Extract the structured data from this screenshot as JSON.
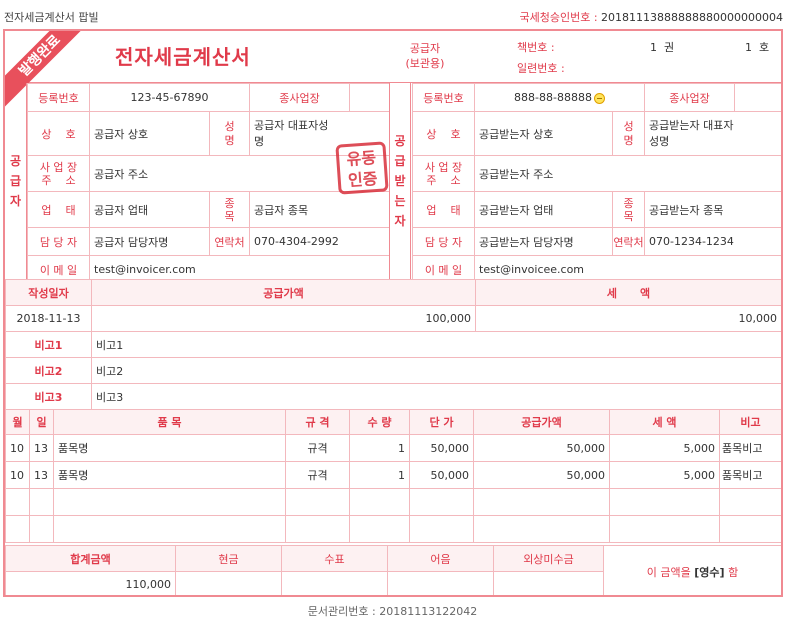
{
  "window": {
    "title": "전자세금계산서 팝빌"
  },
  "approval": {
    "label": "국세청승인번호 : ",
    "number": "20181113888888880000000004"
  },
  "header": {
    "ribbon": "발행완료",
    "title": "전자세금계산서",
    "copy_type": "공급자\n(보관용)",
    "book_label": "책번호 :",
    "serial_label": "일련번호 :",
    "volume": "1  권",
    "ho": "1  호"
  },
  "supplier": {
    "side_label": "공\n급\n자",
    "labels": {
      "reg": "등록번호",
      "branch": "종사업장",
      "name": "상    호",
      "rep": "성\n명",
      "addr": "사 업 장\n주    소",
      "type": "업    태",
      "item": "종\n목",
      "contact": "담 당 자",
      "tel": "연락처",
      "email": "이 메 일"
    },
    "reg_no": "123-45-67890",
    "branch_no": "",
    "company": "공급자 상호",
    "rep_name": "공급자 대표자성\n명",
    "address": "공급자 주소",
    "biz_type": "공급자 업태",
    "biz_item": "공급자 종목",
    "contact_name": "공급자 담당자명",
    "tel": "070-4304-2992",
    "email": "test@invoicer.com",
    "stamp": "유동\n인증"
  },
  "buyer": {
    "side_label": "공\n급\n받\n는\n자",
    "labels": {
      "reg": "등록번호",
      "branch": "종사업장",
      "name": "상    호",
      "rep": "성\n명",
      "addr": "사 업 장\n주    소",
      "type": "업    태",
      "item": "종\n목",
      "contact": "담 당 자",
      "tel": "연락처",
      "email": "이 메 일"
    },
    "reg_no": "888-88-88888",
    "branch_no": "",
    "company": "공급받는자 상호",
    "rep_name": "공급받는자 대표자\n성명",
    "address": "공급받는자 주소",
    "biz_type": "공급받는자 업태",
    "biz_item": "공급받는자 종목",
    "contact_name": "공급받는자 담당자명",
    "tel": "070-1234-1234",
    "email": "test@invoicee.com"
  },
  "amount": {
    "headers": {
      "date": "작성일자",
      "supply": "공급가액",
      "tax": "세      액"
    },
    "date": "2018-11-13",
    "supply": "100,000",
    "tax": "10,000"
  },
  "notes": [
    {
      "label": "비고1",
      "value": "비고1"
    },
    {
      "label": "비고2",
      "value": "비고2"
    },
    {
      "label": "비고3",
      "value": "비고3"
    }
  ],
  "items": {
    "headers": {
      "month": "월",
      "day": "일",
      "name": "품 목",
      "spec": "규 격",
      "qty": "수 량",
      "unit": "단 가",
      "supply": "공급가액",
      "tax": "세 액",
      "remark": "비고"
    },
    "rows": [
      {
        "month": "10",
        "day": "13",
        "name": "품목명",
        "spec": "규격",
        "qty": "1",
        "unit": "50,000",
        "supply": "50,000",
        "tax": "5,000",
        "remark": "품목비고"
      },
      {
        "month": "10",
        "day": "13",
        "name": "품목명",
        "spec": "규격",
        "qty": "1",
        "unit": "50,000",
        "supply": "50,000",
        "tax": "5,000",
        "remark": "품목비고"
      },
      {
        "month": "",
        "day": "",
        "name": "",
        "spec": "",
        "qty": "",
        "unit": "",
        "supply": "",
        "tax": "",
        "remark": ""
      },
      {
        "month": "",
        "day": "",
        "name": "",
        "spec": "",
        "qty": "",
        "unit": "",
        "supply": "",
        "tax": "",
        "remark": ""
      }
    ]
  },
  "summary": {
    "headers": {
      "total": "합계금액",
      "cash": "현금",
      "check": "수표",
      "note": "어음",
      "credit": "외상미수금"
    },
    "total": "110,000",
    "cash": "",
    "check": "",
    "bill": "",
    "credit": "",
    "statement_pre": "이 금액을 ",
    "statement_kind": "[영수]",
    "statement_post": " 함"
  },
  "footer": {
    "doc_no": "문서관리번호 : 20181113122042"
  }
}
